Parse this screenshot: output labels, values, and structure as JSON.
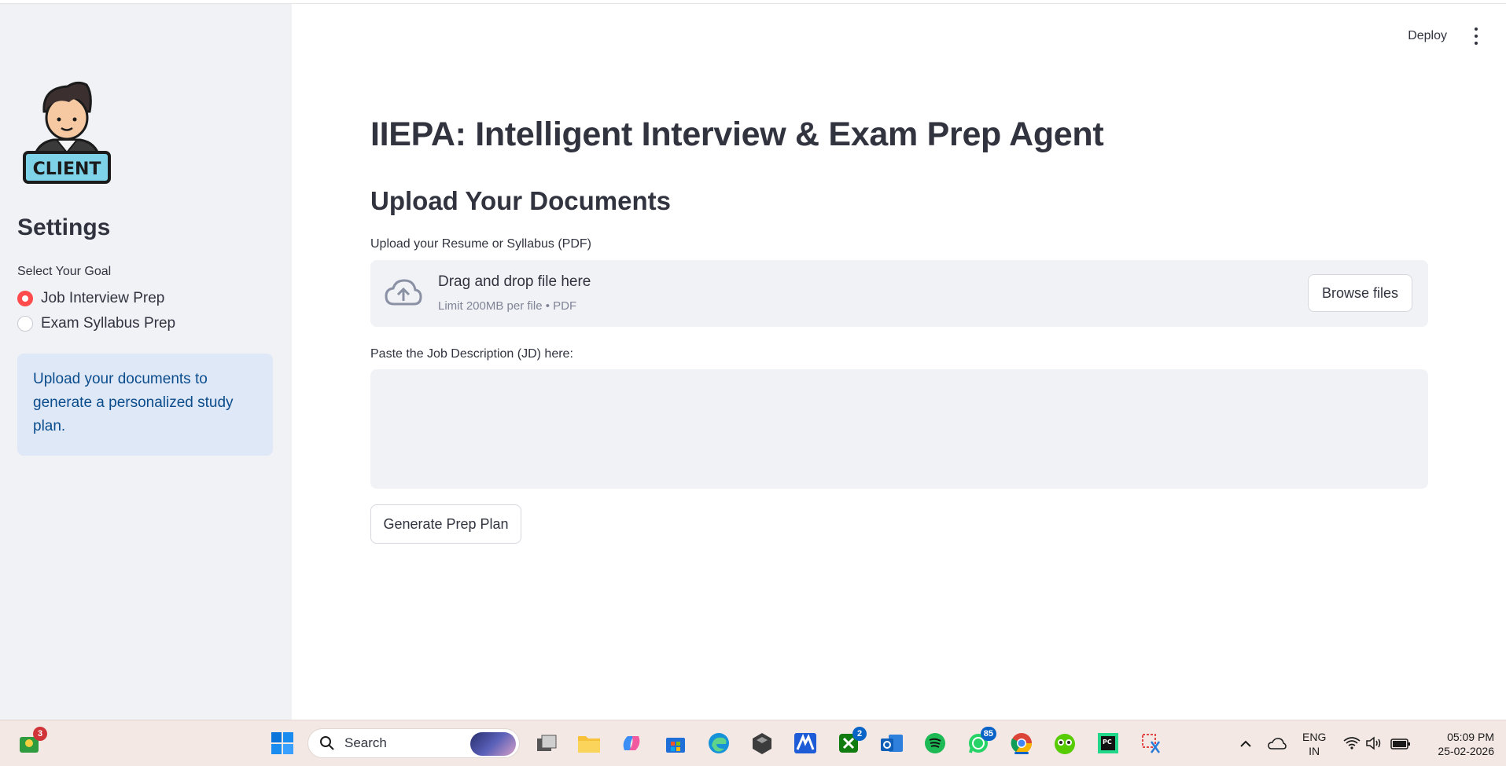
{
  "sidebar": {
    "logo_text": "CLIENT",
    "settings_title": "Settings",
    "goal_label": "Select Your Goal",
    "options": [
      {
        "label": "Job Interview Prep",
        "selected": true
      },
      {
        "label": "Exam Syllabus Prep",
        "selected": false
      }
    ],
    "info_text": "Upload your documents to generate a personalized study plan."
  },
  "header": {
    "deploy_label": "Deploy"
  },
  "main": {
    "title": "IIEPA: Intelligent Interview & Exam Prep Agent",
    "subtitle": "Upload Your Documents",
    "upload_label": "Upload your Resume or Syllabus (PDF)",
    "dropzone_title": "Drag and drop file here",
    "dropzone_sub": "Limit 200MB per file • PDF",
    "browse_label": "Browse files",
    "jd_label": "Paste the Job Description (JD) here:",
    "jd_value": "",
    "generate_label": "Generate Prep Plan"
  },
  "taskbar": {
    "widget_badge": "3",
    "search_label": "Search",
    "xbox_badge": "2",
    "whatsapp_badge": "85",
    "lang_top": "ENG",
    "lang_bottom": "IN",
    "time": "05:09 PM",
    "date": "25-02-2026"
  },
  "colors": {
    "accent": "#ff4b4b",
    "sidebar_bg": "#f0f2f6",
    "info_bg": "#dfe8f7",
    "info_text": "#0a4c8c"
  }
}
